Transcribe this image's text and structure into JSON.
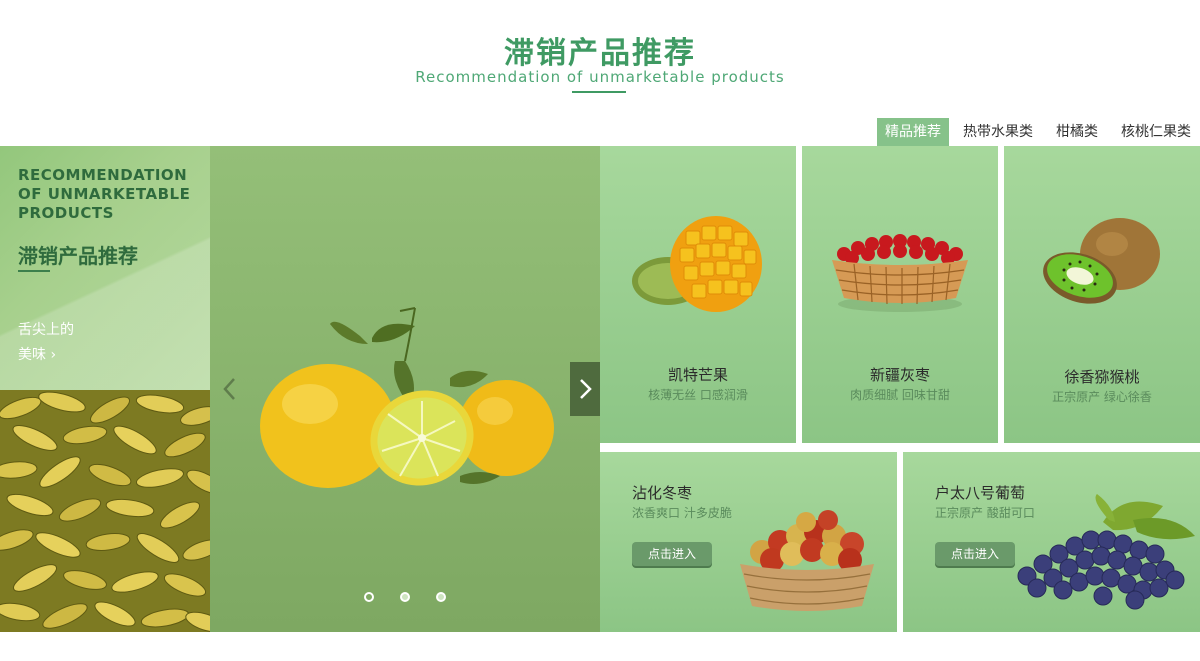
{
  "header": {
    "title": "滞销产品推荐",
    "subtitle": "Recommendation of unmarketable products"
  },
  "tabs": [
    {
      "label": "精品推荐",
      "active": true
    },
    {
      "label": "热带水果类",
      "active": false
    },
    {
      "label": "柑橘类",
      "active": false
    },
    {
      "label": "核桃仁果类",
      "active": false
    }
  ],
  "left_panel": {
    "en_caption": "RECOMMENDATION OF UNMARKETABLE PRODUCTS",
    "cn_caption": "滞销产品推荐",
    "taste_line1": "舌尖上的",
    "taste_line2": "美味 ›"
  },
  "carousel": {
    "prev_icon": "chevron-left-icon",
    "next_icon": "chevron-right-icon",
    "dots": 3,
    "active_dot": 0
  },
  "products": [
    {
      "name": "凯特芒果",
      "desc": "核薄无丝 口感润滑",
      "icon": "mango-icon"
    },
    {
      "name": "新疆灰枣",
      "desc": "肉质细腻 回味甘甜",
      "icon": "jujube-basket-icon"
    },
    {
      "name": "徐香猕猴桃",
      "desc": "正宗原产 绿心徐香",
      "icon": "kiwi-icon"
    }
  ],
  "featured": [
    {
      "name": "沾化冬枣",
      "desc": "浓香爽口 汁多皮脆",
      "button": "点击进入",
      "icon": "winter-jujube-basket-icon"
    },
    {
      "name": "户太八号葡萄",
      "desc": "正宗原产 酸甜可口",
      "button": "点击进入",
      "icon": "grape-icon"
    }
  ],
  "colors": {
    "brand_green": "#3f9a63",
    "tab_active": "#86c28a",
    "card_green": "#9fd294"
  }
}
